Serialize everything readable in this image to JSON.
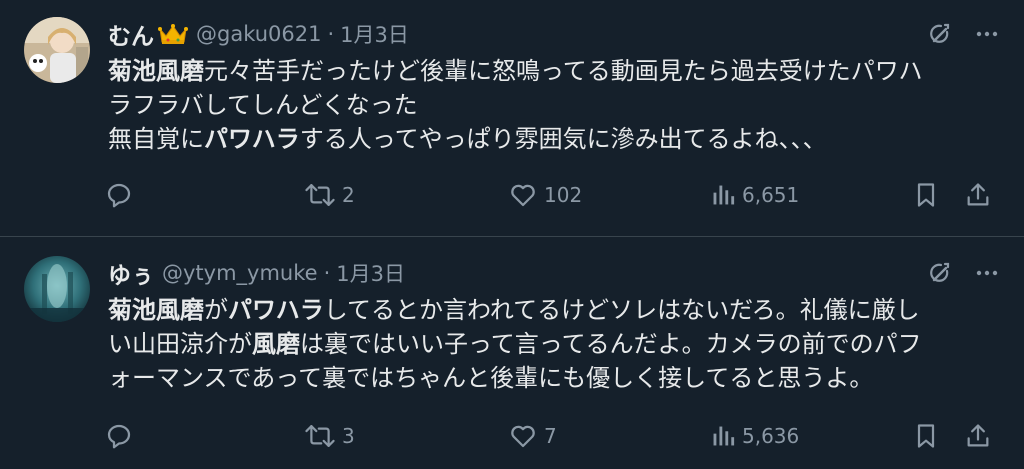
{
  "tweets": [
    {
      "author": {
        "name": "むん",
        "handle": "@gaku0621",
        "has_crown": true
      },
      "separator": "·",
      "date": "1月3日",
      "text_lines": [
        [
          {
            "t": "菊池風磨",
            "b": true
          },
          {
            "t": "元々苦手だったけど後輩に怒鳴ってる動画見たら過去受けたパワハ",
            "b": false
          }
        ],
        [
          {
            "t": "ラフラバしてしんどくなった",
            "b": false
          }
        ],
        [
          {
            "t": "無自覚に",
            "b": false
          },
          {
            "t": "パワハラ",
            "b": true
          },
          {
            "t": "する人ってやっぱり雰囲気に滲み出てるよね、、、",
            "b": false
          }
        ]
      ],
      "stats": {
        "replies": "",
        "retweets": "2",
        "likes": "102",
        "views": "6,651"
      }
    },
    {
      "author": {
        "name": "ゆぅ",
        "handle": "@ytym_ymuke",
        "has_crown": false
      },
      "separator": "·",
      "date": "1月3日",
      "text_lines": [
        [
          {
            "t": "菊池風磨",
            "b": true
          },
          {
            "t": "が",
            "b": false
          },
          {
            "t": "パワハラ",
            "b": true
          },
          {
            "t": "してるとか言われてるけどソレはないだろ。礼儀に厳し",
            "b": false
          }
        ],
        [
          {
            "t": "い山田涼介が",
            "b": false
          },
          {
            "t": "風磨",
            "b": true
          },
          {
            "t": "は裏ではいい子って言ってるんだよ。カメラの前でのパフ",
            "b": false
          }
        ],
        [
          {
            "t": "ォーマンスであって裏ではちゃんと後輩にも優しく接してると思うよ。",
            "b": false
          }
        ]
      ],
      "stats": {
        "replies": "",
        "retweets": "3",
        "likes": "7",
        "views": "5,636"
      }
    }
  ],
  "colors": {
    "background": "#15202b",
    "text": "#e7e9ea",
    "muted": "#8b98a5",
    "divider": "#38444d"
  },
  "icons": [
    "grok-icon",
    "more-icon",
    "reply-icon",
    "retweet-icon",
    "like-icon",
    "views-icon",
    "bookmark-icon",
    "share-icon",
    "crown-icon"
  ]
}
